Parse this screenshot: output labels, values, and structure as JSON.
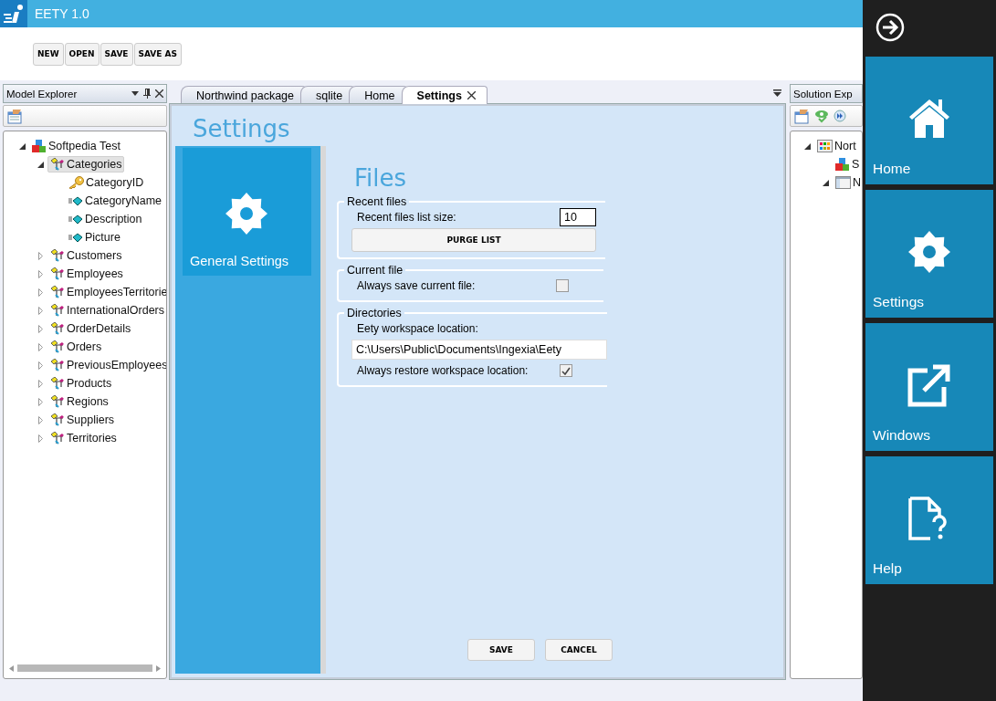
{
  "window": {
    "title": "EETY 1.0"
  },
  "toolbar": {
    "buttons": [
      "NEW",
      "OPEN",
      "SAVE",
      "SAVE AS"
    ]
  },
  "model_explorer": {
    "title": "Model Explorer",
    "tree": [
      {
        "label": "Softpedia Test",
        "kind": "model",
        "expanded": true,
        "selected": false,
        "children": [
          {
            "label": "Categories",
            "kind": "entity",
            "expanded": true,
            "selected": true,
            "children": [
              {
                "label": "CategoryID",
                "kind": "key",
                "selected": false
              },
              {
                "label": "CategoryName",
                "kind": "field",
                "selected": false
              },
              {
                "label": "Description",
                "kind": "field",
                "selected": false
              },
              {
                "label": "Picture",
                "kind": "field",
                "selected": false
              }
            ]
          },
          {
            "label": "Customers",
            "kind": "entity",
            "expanded": false,
            "selected": false
          },
          {
            "label": "Employees",
            "kind": "entity",
            "expanded": false,
            "selected": false
          },
          {
            "label": "EmployeesTerritorie",
            "kind": "entity",
            "expanded": false,
            "selected": false
          },
          {
            "label": "InternationalOrders",
            "kind": "entity",
            "expanded": false,
            "selected": false
          },
          {
            "label": "OrderDetails",
            "kind": "entity",
            "expanded": false,
            "selected": false
          },
          {
            "label": "Orders",
            "kind": "entity",
            "expanded": false,
            "selected": false
          },
          {
            "label": "PreviousEmployees",
            "kind": "entity",
            "expanded": false,
            "selected": false
          },
          {
            "label": "Products",
            "kind": "entity",
            "expanded": false,
            "selected": false
          },
          {
            "label": "Regions",
            "kind": "entity",
            "expanded": false,
            "selected": false
          },
          {
            "label": "Suppliers",
            "kind": "entity",
            "expanded": false,
            "selected": false
          },
          {
            "label": "Territories",
            "kind": "entity",
            "expanded": false,
            "selected": false
          }
        ]
      }
    ]
  },
  "tabs": [
    {
      "label": "Northwind package",
      "selected": false,
      "closable": false
    },
    {
      "label": "sqlite",
      "selected": false,
      "closable": false
    },
    {
      "label": "Home",
      "selected": false,
      "closable": false
    },
    {
      "label": "Settings",
      "selected": true,
      "closable": true
    }
  ],
  "settings": {
    "title": "Settings",
    "nav": [
      {
        "label": "General Settings",
        "selected": true
      }
    ],
    "section": "Files",
    "groups": [
      {
        "title": "Recent files",
        "rows": [
          {
            "kind": "number",
            "label": "Recent files list size:",
            "value": "10"
          },
          {
            "kind": "button",
            "label": "PURGE LIST"
          }
        ]
      },
      {
        "title": "Current file",
        "rows": [
          {
            "kind": "checkbox",
            "label": "Always save current file:",
            "checked": false
          }
        ]
      },
      {
        "title": "Directories",
        "rows": [
          {
            "kind": "label",
            "label": "Eety workspace location:"
          },
          {
            "kind": "path",
            "value": "C:\\Users\\Public\\Documents\\Ingexia\\Eety"
          },
          {
            "kind": "checkbox",
            "label": "Always restore workspace location:",
            "checked": true
          }
        ]
      }
    ],
    "buttons": [
      "SAVE",
      "CANCEL"
    ]
  },
  "solution_explorer": {
    "title": "Solution Exp",
    "tree": [
      {
        "label": "Nort",
        "kind": "package",
        "expanded": true,
        "children": [
          {
            "label": "S",
            "kind": "model"
          },
          {
            "label": "N",
            "kind": "diagram",
            "expanded": true
          }
        ]
      }
    ]
  },
  "charms": [
    {
      "label": "Home",
      "kind": "home"
    },
    {
      "label": "Settings",
      "kind": "settings"
    },
    {
      "label": "Windows",
      "kind": "windows"
    },
    {
      "label": "Help",
      "kind": "help"
    }
  ]
}
